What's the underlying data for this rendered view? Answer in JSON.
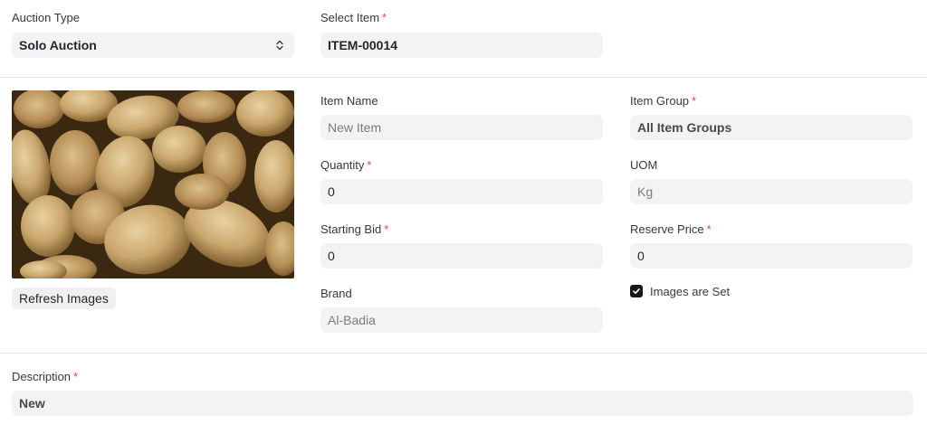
{
  "top": {
    "auction_type": {
      "label": "Auction Type",
      "value": "Solo Auction"
    },
    "select_item": {
      "label": "Select Item",
      "required_mark": "*",
      "value": "ITEM-00014"
    }
  },
  "item": {
    "refresh_images_label": "Refresh Images",
    "item_name": {
      "label": "Item Name",
      "placeholder": "New Item"
    },
    "item_group": {
      "label": "Item Group",
      "required_mark": "*",
      "value": "All Item Groups"
    },
    "quantity": {
      "label": "Quantity",
      "required_mark": "*",
      "value": "0"
    },
    "uom": {
      "label": "UOM",
      "value": "Kg"
    },
    "starting_bid": {
      "label": "Starting Bid",
      "required_mark": "*",
      "value": "0"
    },
    "reserve_price": {
      "label": "Reserve Price",
      "required_mark": "*",
      "value": "0"
    },
    "brand": {
      "label": "Brand",
      "value": "Al-Badia"
    },
    "images_set": {
      "label": "Images are Set",
      "checked": true
    }
  },
  "description": {
    "label": "Description",
    "required_mark": "*",
    "value": "New"
  },
  "colors": {
    "required": "#e24c4c",
    "field_bg": "#f3f3f3",
    "checkbox": "#171717"
  },
  "icons": {
    "select_arrow": "chevron-up-down-icon",
    "checkbox": "check-icon"
  }
}
